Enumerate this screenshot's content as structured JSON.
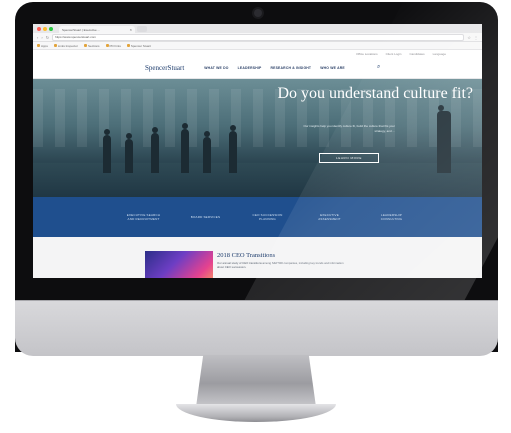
{
  "browser": {
    "tab_title": "SpencerStuart | Executive ...",
    "url": "https://www.spencerstuart.com",
    "bookmarks": [
      "Apps",
      "Links Inspector",
      "Sections",
      "PD hints",
      "Spencer Stuart"
    ],
    "traffic_colors": [
      "#ff5f57",
      "#febc2e",
      "#28c840"
    ]
  },
  "site": {
    "utility_links": [
      "Office Locations",
      "Client Login",
      "Candidates",
      "Language"
    ],
    "logo": "SpencerStuart",
    "nav": [
      "WHAT WE DO",
      "LEADERSHIP",
      "RESEARCH & INSIGHT",
      "WHO WE ARE"
    ],
    "hero": {
      "title": "Do you understand culture fit?",
      "body": "Our insights help you identify culture fit, build the culture that fits your strategy, and ...",
      "cta": "LEARN MORE"
    },
    "services": [
      "EXECUTIVE SEARCH AND RECRUITMENT",
      "BOARD SERVICES",
      "CEO SUCCESSION PLANNING",
      "EXECUTIVE ASSESSMENT",
      "LEADERSHIP CONSULTING"
    ],
    "feature": {
      "title": "2018 CEO Transitions",
      "body": "Our annual study of CEO transitions among S&P 500 companies, including key trends and information about CEO succession."
    }
  },
  "colors": {
    "brand": "#1b3a6b",
    "services_band": "#1f4f8e"
  }
}
